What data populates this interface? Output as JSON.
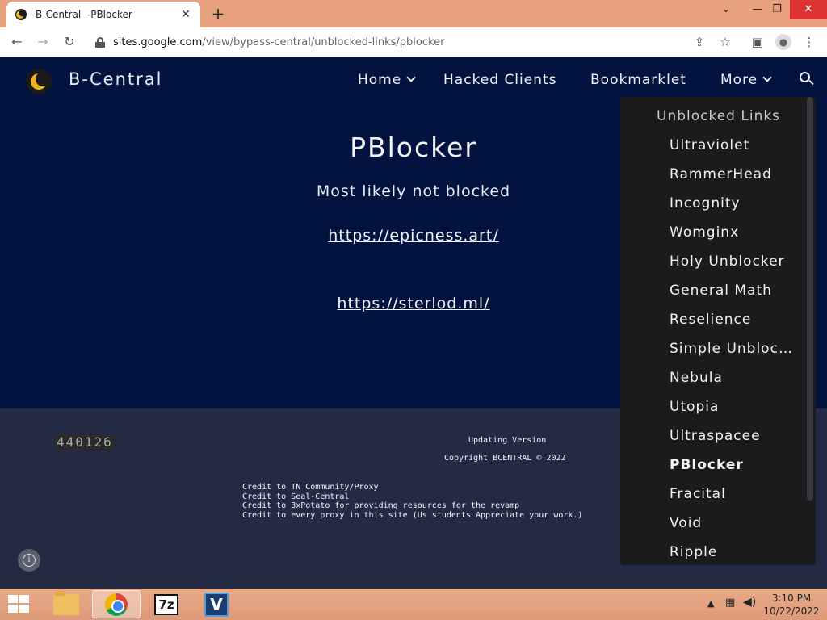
{
  "browser": {
    "tab_title": "B-Central - PBlocker",
    "tab_close": "✕",
    "new_tab": "+",
    "url_host": "sites.google.com",
    "url_path": "/view/bypass-central/unblocked-links/pblocker"
  },
  "site": {
    "brand": "B-Central",
    "nav": {
      "home": "Home",
      "hacked_clients": "Hacked Clients",
      "bookmarklet": "Bookmarklet",
      "more": "More"
    },
    "page_title": "PBlocker",
    "subtitle": "Most likely not blocked",
    "links": [
      "https://epicness.art/",
      "https://sterlod.ml/"
    ]
  },
  "footer": {
    "counter": "440126",
    "updating": "Updating Version",
    "copyright": "Copyright BCENTRAL © 2022",
    "credits": [
      "Credit to TN Community/Proxy",
      "Credit to Seal-Central",
      "Credit to 3xPotato for providing resources for the revamp",
      "Credit to every proxy in this site (Us students Appreciate your work.)"
    ]
  },
  "dropdown": {
    "heading": "Unblocked Links",
    "items": [
      "Ultraviolet",
      "RammerHead",
      "Incognity",
      "Womginx",
      "Holy Unblocker",
      "General Math",
      "Reselience",
      "Simple Unblocker",
      "Nebula",
      "Utopia",
      "Ultraspacee",
      "PBlocker",
      "Fracital",
      "Void",
      "Ripple"
    ],
    "active_item": "PBlocker"
  },
  "taskbar": {
    "apps": [
      "file-explorer",
      "chrome",
      "7-zip",
      "vegas"
    ],
    "sevenz_label": "7z",
    "v_label": "V",
    "time": "3:10 PM",
    "date": "10/22/2022"
  },
  "colors": {
    "site_bg": "#03133f",
    "footer_bg": "#232a44",
    "dropdown_bg": "#1b1b1e",
    "titlebar": "#e8a07e"
  }
}
